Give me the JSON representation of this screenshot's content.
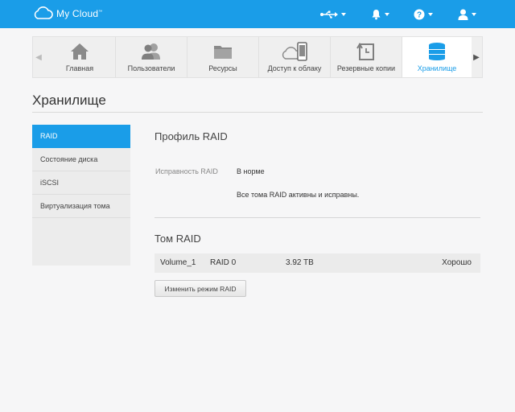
{
  "header": {
    "logo_text": "My Cloud",
    "logo_mark": "™",
    "icons": [
      "usb-icon",
      "bell-icon",
      "help-icon",
      "user-icon"
    ]
  },
  "nav": {
    "items": [
      {
        "label": "Главная",
        "icon": "home-icon"
      },
      {
        "label": "Пользователи",
        "icon": "users-icon"
      },
      {
        "label": "Ресурсы",
        "icon": "folder-icon"
      },
      {
        "label": "Доступ к облаку",
        "icon": "cloud-device-icon"
      },
      {
        "label": "Резервные копии",
        "icon": "backup-icon"
      },
      {
        "label": "Хранилище",
        "icon": "storage-icon"
      }
    ],
    "active": "Хранилище"
  },
  "page": {
    "title": "Хранилище"
  },
  "sidebar": {
    "items": [
      {
        "label": "RAID"
      },
      {
        "label": "Состояние диска"
      },
      {
        "label": "iSCSI"
      },
      {
        "label": "Виртуализация тома"
      }
    ],
    "active": "RAID"
  },
  "raid_profile": {
    "heading": "Профиль RAID",
    "health_label": "Исправность RAID",
    "health_value": "В норме",
    "health_note": "Все тома RAID активны и исправны."
  },
  "raid_volume": {
    "heading": "Том RAID",
    "rows": [
      {
        "name": "Volume_1",
        "level": "RAID 0",
        "size": "3.92 TB",
        "status": "Хорошо"
      }
    ],
    "change_button": "Изменить режим RAID"
  },
  "colors": {
    "accent": "#1a9de8",
    "background": "#f6f6f7"
  }
}
